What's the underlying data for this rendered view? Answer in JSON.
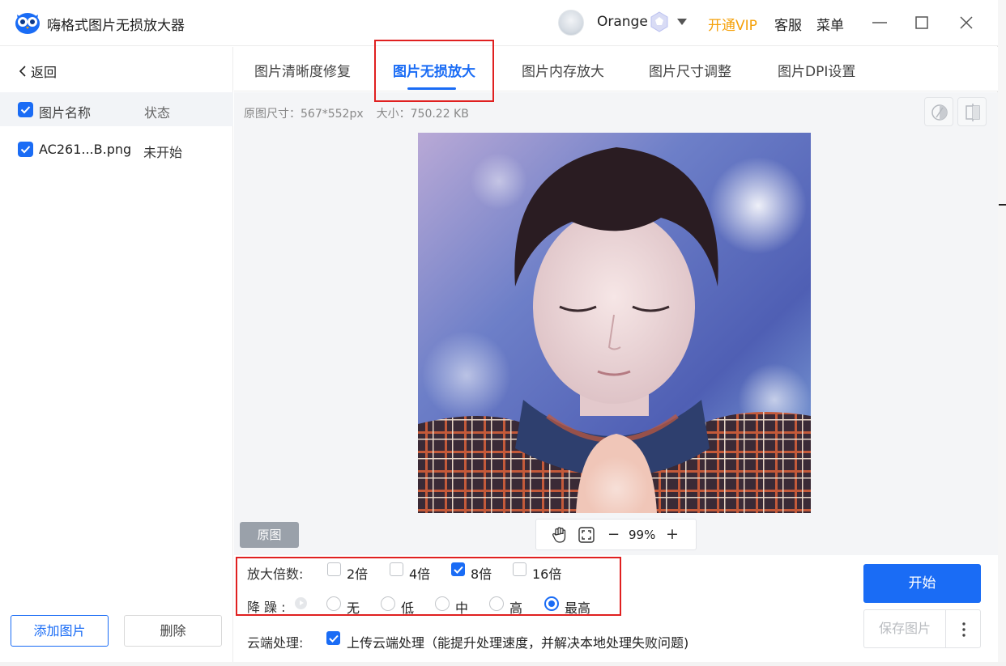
{
  "app": {
    "title": "嗨格式图片无损放大器",
    "username": "Orange",
    "vip": "开通VIP",
    "service": "客服",
    "menu": "菜单"
  },
  "sidebar": {
    "back": "返回",
    "header_name": "图片名称",
    "header_status": "状态",
    "files": [
      {
        "name": "AC261...B.png",
        "status": "未开始"
      }
    ],
    "add_button": "添加图片",
    "delete_button": "删除"
  },
  "tabs": [
    {
      "label": "图片清晰度修复",
      "active": false
    },
    {
      "label": "图片无损放大",
      "active": true
    },
    {
      "label": "图片内存放大",
      "active": false
    },
    {
      "label": "图片尺寸调整",
      "active": false
    },
    {
      "label": "图片DPI设置",
      "active": false
    }
  ],
  "preview": {
    "dimension": "原图尺寸：567*552px",
    "size": "大小：750.22 KB",
    "original_button": "原图",
    "zoom": "99%",
    "zoom_minus": "−",
    "zoom_plus": "+"
  },
  "options": {
    "scale_label": "放大倍数:",
    "scales": [
      {
        "label": "2倍",
        "checked": false
      },
      {
        "label": "4倍",
        "checked": false
      },
      {
        "label": "8倍",
        "checked": true
      },
      {
        "label": "16倍",
        "checked": false
      }
    ],
    "noise_label": "降 躁 :",
    "noise_levels": [
      {
        "label": "无",
        "checked": false
      },
      {
        "label": "低",
        "checked": false
      },
      {
        "label": "中",
        "checked": false
      },
      {
        "label": "高",
        "checked": false
      },
      {
        "label": "最高",
        "checked": true
      }
    ],
    "cloud_label": "云端处理:",
    "cloud_option": "上传云端处理（能提升处理速度，并解决本地处理失败问题)",
    "cloud_checked": true
  },
  "actions": {
    "start": "开始",
    "save": "保存图片"
  },
  "colors": {
    "accent": "#1a6cf5",
    "vip": "#f5a10a",
    "highlight": "#e02020"
  }
}
